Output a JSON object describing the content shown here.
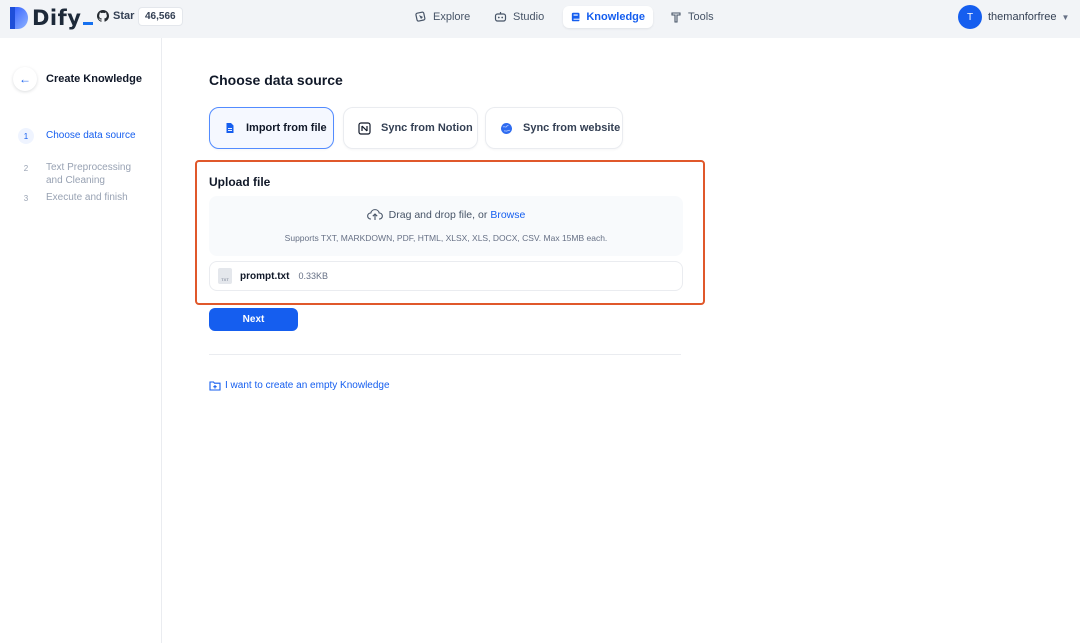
{
  "header": {
    "logo_text": "Dify",
    "github": {
      "star_label": "Star",
      "star_count": "46,566"
    },
    "nav": [
      {
        "label": "Explore",
        "icon": "explore-icon"
      },
      {
        "label": "Studio",
        "icon": "studio-icon"
      },
      {
        "label": "Knowledge",
        "icon": "knowledge-icon",
        "active": true
      },
      {
        "label": "Tools",
        "icon": "tools-icon"
      }
    ],
    "user": {
      "initial": "T",
      "name": "themanforfree"
    }
  },
  "sidebar": {
    "title": "Create Knowledge",
    "steps": [
      {
        "num": "1",
        "label": "Choose data source",
        "active": true
      },
      {
        "num": "2",
        "label": "Text Preprocessing and Cleaning"
      },
      {
        "num": "3",
        "label": "Execute and finish"
      }
    ]
  },
  "main": {
    "section_title": "Choose data source",
    "sources": [
      {
        "label": "Import from file",
        "icon": "file-icon",
        "active": true
      },
      {
        "label": "Sync from Notion",
        "icon": "notion-icon"
      },
      {
        "label": "Sync from website",
        "icon": "website-icon"
      }
    ],
    "upload": {
      "title": "Upload file",
      "drop_text": "Drag and drop file, or",
      "browse_label": "Browse",
      "supports": "Supports TXT, MARKDOWN, PDF, HTML, XLSX, XLS, DOCX, CSV. Max 15MB each.",
      "file": {
        "type": "TXT",
        "name": "prompt.txt",
        "size": "0.33KB"
      }
    },
    "next_label": "Next",
    "empty_link": "I want to create an empty Knowledge"
  },
  "colors": {
    "accent": "#155eef",
    "highlight_border": "#e0582b"
  }
}
